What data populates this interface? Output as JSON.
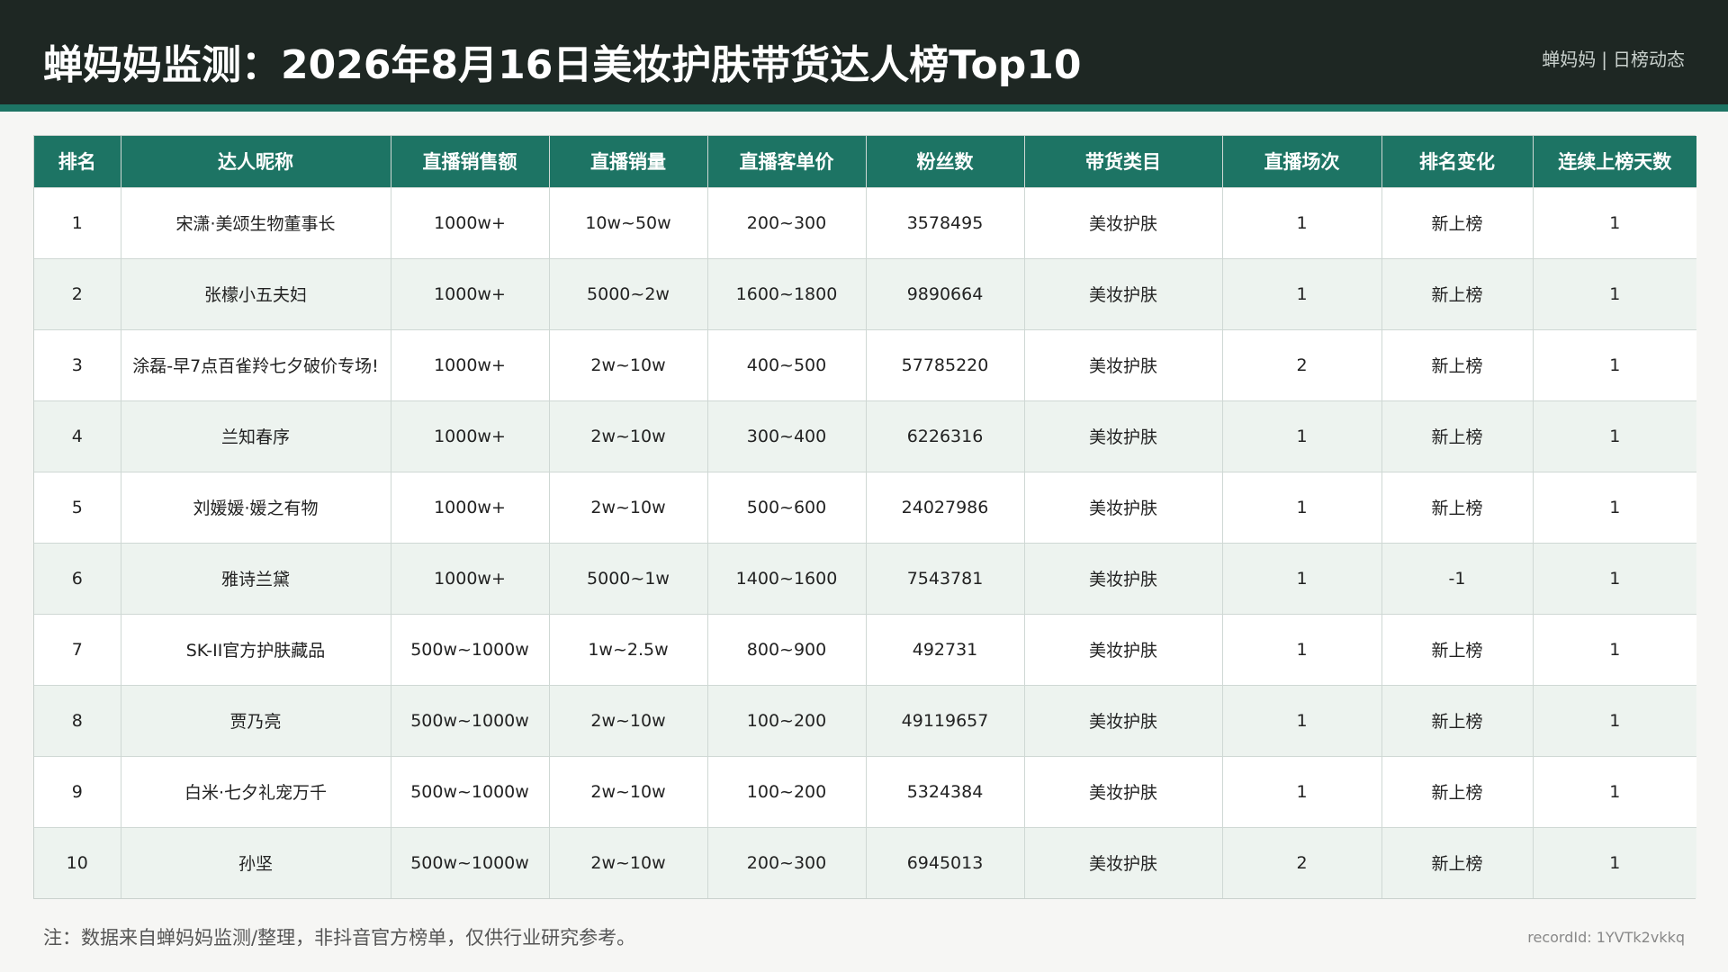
{
  "header": {
    "title": "蝉妈妈监测：2026年8月16日美妆护肤带货达人榜Top10",
    "brand_name": "蝉妈妈",
    "brand_separator": "|",
    "brand_section": "日榜动态"
  },
  "table": {
    "columns": [
      "排名",
      "达人昵称",
      "直播销售额",
      "直播销量",
      "直播客单价",
      "粉丝数",
      "带货类目",
      "直播场次",
      "排名变化",
      "连续上榜天数"
    ],
    "rows": [
      [
        "1",
        "宋潇·美颂生物董事长",
        "1000w+",
        "10w~50w",
        "200~300",
        "3578495",
        "美妆护肤",
        "1",
        "新上榜",
        "1"
      ],
      [
        "2",
        "张檬小五夫妇",
        "1000w+",
        "5000~2w",
        "1600~1800",
        "9890664",
        "美妆护肤",
        "1",
        "新上榜",
        "1"
      ],
      [
        "3",
        "涂磊-早7点百雀羚七夕破价专场!",
        "1000w+",
        "2w~10w",
        "400~500",
        "57785220",
        "美妆护肤",
        "2",
        "新上榜",
        "1"
      ],
      [
        "4",
        "兰知春序",
        "1000w+",
        "2w~10w",
        "300~400",
        "6226316",
        "美妆护肤",
        "1",
        "新上榜",
        "1"
      ],
      [
        "5",
        "刘媛媛·媛之有物",
        "1000w+",
        "2w~10w",
        "500~600",
        "24027986",
        "美妆护肤",
        "1",
        "新上榜",
        "1"
      ],
      [
        "6",
        "雅诗兰黛",
        "1000w+",
        "5000~1w",
        "1400~1600",
        "7543781",
        "美妆护肤",
        "1",
        "-1",
        "1"
      ],
      [
        "7",
        "SK-II官方护肤藏品",
        "500w~1000w",
        "1w~2.5w",
        "800~900",
        "492731",
        "美妆护肤",
        "1",
        "新上榜",
        "1"
      ],
      [
        "8",
        "贾乃亮",
        "500w~1000w",
        "2w~10w",
        "100~200",
        "49119657",
        "美妆护肤",
        "1",
        "新上榜",
        "1"
      ],
      [
        "9",
        "白米·七夕礼宠万千",
        "500w~1000w",
        "2w~10w",
        "100~200",
        "5324384",
        "美妆护肤",
        "1",
        "新上榜",
        "1"
      ],
      [
        "10",
        "孙坚",
        "500w~1000w",
        "2w~10w",
        "200~300",
        "6945013",
        "美妆护肤",
        "2",
        "新上榜",
        "1"
      ]
    ]
  },
  "footer": {
    "note": "注：数据来自蝉妈妈监测/整理，非抖音官方榜单，仅供行业研究参考。",
    "record_id": "recordId: 1YVTk2vkkq"
  },
  "colors": {
    "header_bg": "#1e2723",
    "accent": "#1d7464",
    "row_alt": "#edf3ef"
  }
}
